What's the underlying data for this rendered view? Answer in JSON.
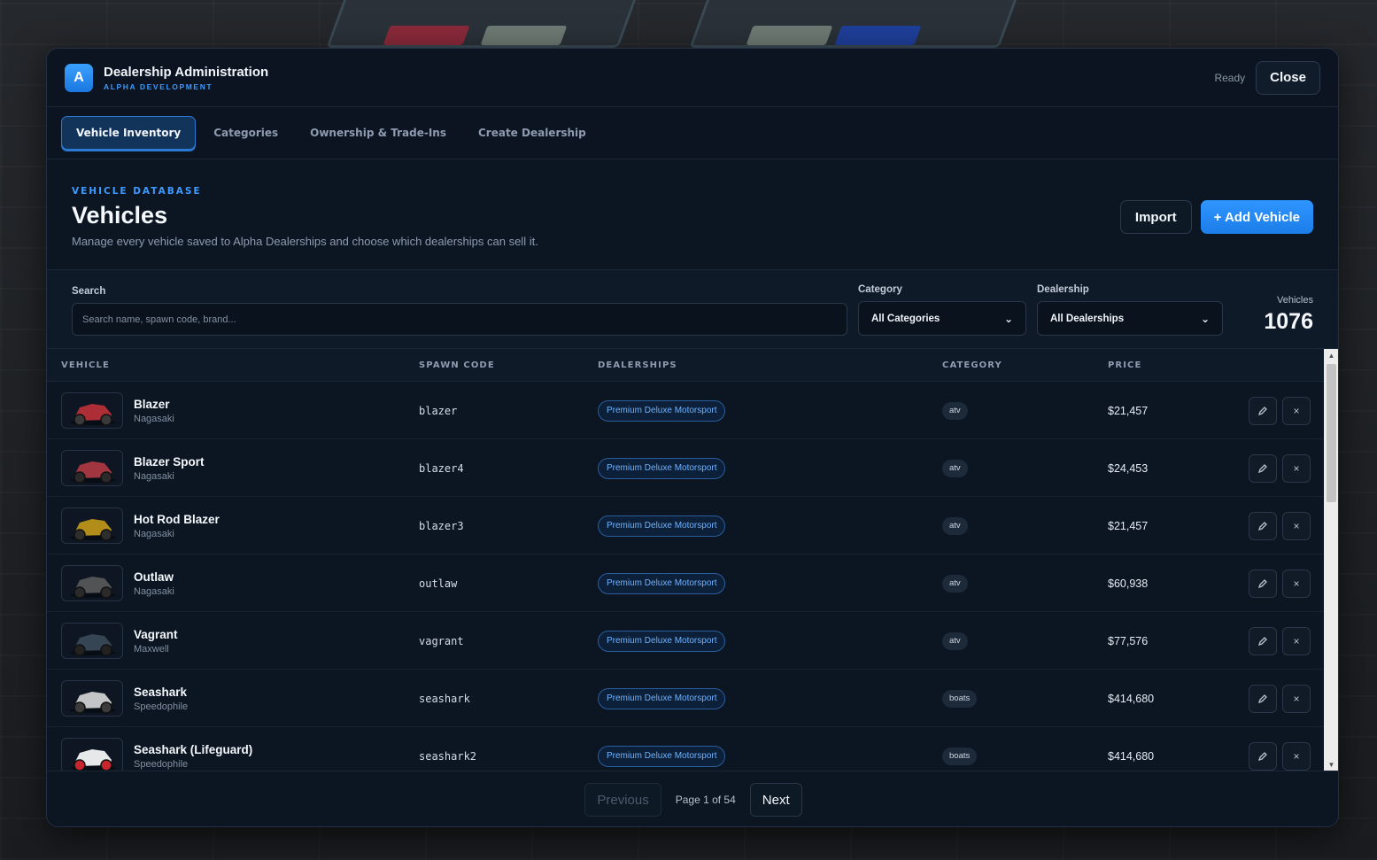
{
  "app": {
    "logo_letter": "A",
    "title": "Dealership Administration",
    "subtitle": "ALPHA DEVELOPMENT",
    "status": "Ready",
    "close_label": "Close"
  },
  "tabs": [
    {
      "label": "Vehicle Inventory",
      "active": true
    },
    {
      "label": "Categories",
      "active": false
    },
    {
      "label": "Ownership & Trade-Ins",
      "active": false
    },
    {
      "label": "Create Dealership",
      "active": false
    }
  ],
  "header": {
    "eyebrow": "VEHICLE DATABASE",
    "title": "Vehicles",
    "description": "Manage every vehicle saved to Alpha Dealerships and choose which dealerships can sell it.",
    "import_label": "Import",
    "add_label": "+ Add Vehicle"
  },
  "filters": {
    "search_label": "Search",
    "search_placeholder": "Search name, spawn code, brand...",
    "category_label": "Category",
    "category_value": "All Categories",
    "dealership_label": "Dealership",
    "dealership_value": "All Dealerships",
    "count_label": "Vehicles",
    "count_value": "1076"
  },
  "table": {
    "columns": [
      "VEHICLE",
      "SPAWN CODE",
      "DEALERSHIPS",
      "CATEGORY",
      "PRICE"
    ],
    "rows": [
      {
        "name": "Blazer",
        "brand": "Nagasaki",
        "spawn": "blazer",
        "dealership": "Premium Deluxe Motorsport",
        "category": "atv",
        "price": "$21,457"
      },
      {
        "name": "Blazer Sport",
        "brand": "Nagasaki",
        "spawn": "blazer4",
        "dealership": "Premium Deluxe Motorsport",
        "category": "atv",
        "price": "$24,453"
      },
      {
        "name": "Hot Rod Blazer",
        "brand": "Nagasaki",
        "spawn": "blazer3",
        "dealership": "Premium Deluxe Motorsport",
        "category": "atv",
        "price": "$21,457"
      },
      {
        "name": "Outlaw",
        "brand": "Nagasaki",
        "spawn": "outlaw",
        "dealership": "Premium Deluxe Motorsport",
        "category": "atv",
        "price": "$60,938"
      },
      {
        "name": "Vagrant",
        "brand": "Maxwell",
        "spawn": "vagrant",
        "dealership": "Premium Deluxe Motorsport",
        "category": "atv",
        "price": "$77,576"
      },
      {
        "name": "Seashark",
        "brand": "Speedophile",
        "spawn": "seashark",
        "dealership": "Premium Deluxe Motorsport",
        "category": "boats",
        "price": "$414,680"
      },
      {
        "name": "Seashark (Lifeguard)",
        "brand": "Speedophile",
        "spawn": "seashark2",
        "dealership": "Premium Deluxe Motorsport",
        "category": "boats",
        "price": "$414,680"
      }
    ],
    "edit_icon": "pencil-icon",
    "delete_icon": "close-icon"
  },
  "pagination": {
    "previous_label": "Previous",
    "page_info": "Page 1 of 54",
    "next_label": "Next"
  },
  "colors": {
    "accent": "#2f95ff",
    "panel": "#0c1522",
    "dealer_pill_text": "#6fb2ff"
  }
}
